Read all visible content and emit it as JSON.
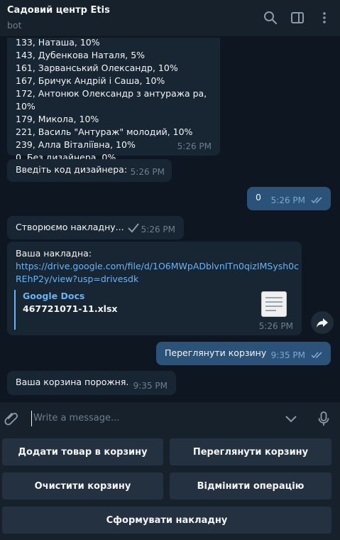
{
  "header": {
    "title": "Садовий центр Etis",
    "subtitle": "bot"
  },
  "messages": {
    "designers": {
      "lines": [
        "133, Наташа, 10%",
        "143, Дубенкова Наталя, 5%",
        "161, Зарванський Олександр, 10%",
        "167, Бричук Андрій і Саша, 10%",
        "172, Антонюк Олександр з антуража ра, 10%",
        "179, Микола, 10%",
        "221, Василь \"Антураж\" молодий, 10%",
        "239, Алла Віталіївна, 10%",
        "0, Без дизайнера, 0%"
      ],
      "time": "5:26 PM"
    },
    "enter_code": {
      "text": "Введіть код дизайнера:",
      "time": "5:26 PM"
    },
    "out_zero": {
      "text": "0",
      "time": "5:26 PM"
    },
    "creating": {
      "text": "Створюємо накладну...",
      "time": "5:26 PM"
    },
    "invoice": {
      "text": "Ваша накладна:",
      "link_line1": "https://drive.google.com/file/d/1O6MWpADblvnITn0qizIMSysh0c",
      "link_line2": "REhP2y/view?usp=drivesdk",
      "preview_site": "Google Docs",
      "preview_file": "467721071-11.xlsx",
      "time": "5:26 PM"
    },
    "out_view_cart": {
      "text": "Переглянути корзину",
      "time": "9:35 PM"
    },
    "cart_empty": {
      "text": "Ваша корзина порожня.",
      "time": "9:35 PM"
    }
  },
  "composer": {
    "placeholder": "Write a message..."
  },
  "keyboard": {
    "add_to_cart": "Додати товар в корзину",
    "view_cart": "Переглянути корзину",
    "clear_cart": "Очистити корзину",
    "cancel_operation": "Відмінити операцію",
    "create_invoice": "Сформувати накладну"
  },
  "icons": {
    "search": "search-icon",
    "sidebar": "sidebar-toggle-icon",
    "more": "more-vertical-icon",
    "attach": "paperclip-icon",
    "chevron": "chevron-down-icon",
    "mic": "microphone-icon",
    "forward": "forward-icon",
    "checks": "double-check-icon"
  },
  "colors": {
    "background": "#0e1621",
    "panel": "#17212b",
    "incoming_bubble": "#182533",
    "outgoing_bubble": "#2b5278",
    "link": "#6ab3f3",
    "keyboard_button": "#243140"
  }
}
